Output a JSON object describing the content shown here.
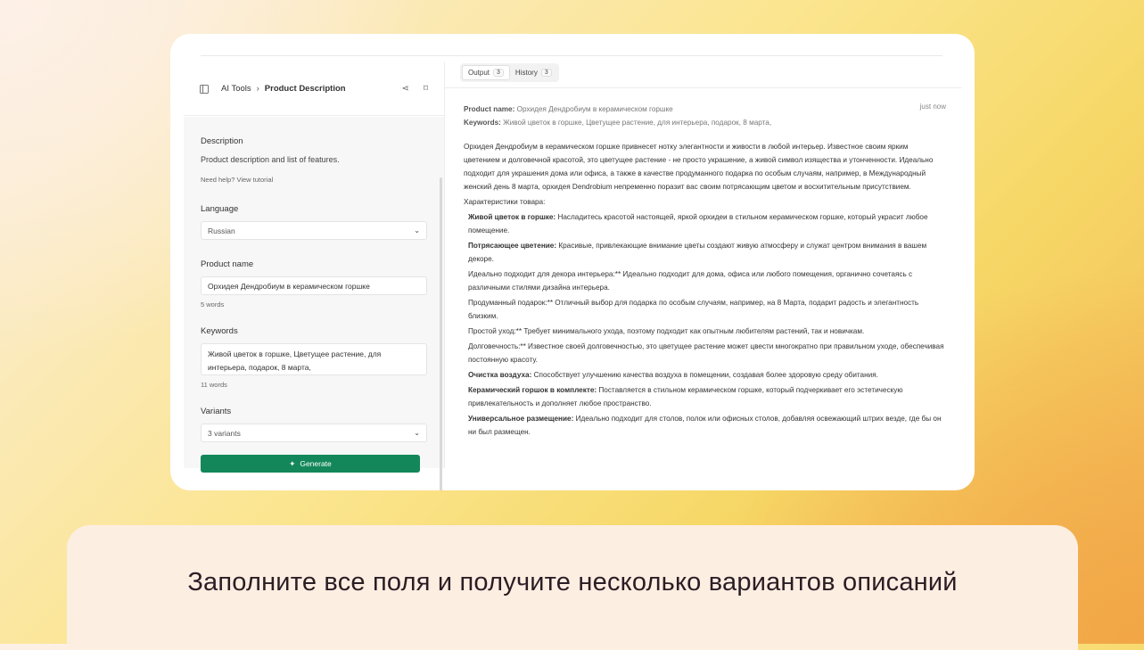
{
  "header": {
    "crumb_root": "AI Tools",
    "crumb_sep": "›",
    "crumb_current": "Product Description",
    "share_glyph": "⋖",
    "bookmark_glyph": "⌑"
  },
  "form": {
    "description_label": "Description",
    "description_text": "Product description and list of features.",
    "help_text": "Need help? View tutorial",
    "language_label": "Language",
    "language_value": "Russian",
    "product_name_label": "Product name",
    "product_name_value": "Орхидея Дендробиум в керамическом горшке",
    "product_name_count": "5 words",
    "keywords_label": "Keywords",
    "keywords_value": "Живой цветок в горшке, Цветущее растение, для интерьера, подарок, 8 марта,",
    "keywords_count": "11 words",
    "variants_label": "Variants",
    "variants_value": "3 variants",
    "generate_label": "Generate"
  },
  "tabs": [
    {
      "label": "Output",
      "count": "3"
    },
    {
      "label": "History",
      "count": "3"
    }
  ],
  "output": {
    "product_name_key": "Product name:",
    "product_name_val": "Орхидея Дендробиум в керамическом горшке",
    "keywords_key": "Keywords:",
    "keywords_val": "Живой цветок в горшке, Цветущее растение, для интерьера, подарок, 8 марта,",
    "timestamp": "just now",
    "intro": "Орхидея Дендробиум в керамическом горшке привнесет нотку элегантности и живости в любой интерьер. Известное своим ярким цветением и долговечной красотой, это цветущее растение - не просто украшение, а живой символ изящества и утонченности. Идеально подходит для украшения дома или офиса, а также в качестве продуманного подарка по особым случаям, например, в Международный женский день 8 марта, орхидея Dendrobium непременно поразит вас своим потрясающим цветом и восхитительным присутствием.",
    "features_heading": "Характеристики товара:",
    "features": [
      {
        "bold": "Живой цветок в горшке:",
        "text": " Насладитесь красотой настоящей, яркой орхидеи в стильном керамическом горшке, который украсит любое помещение."
      },
      {
        "bold": "Потрясающее цветение:",
        "text": " Красивые, привлекающие внимание цветы создают живую атмосферу и служат центром внимания в вашем декоре."
      },
      {
        "bold": "",
        "text": "Идеально подходит для декора интерьера:** Идеально подходит для дома, офиса или любого помещения, органично сочетаясь с различными стилями дизайна интерьера."
      },
      {
        "bold": "",
        "text": "Продуманный подарок:** Отличный выбор для подарка по особым случаям, например, на 8 Марта, подарит радость и элегантность близким."
      },
      {
        "bold": "",
        "text": "Простой уход:** Требует минимального ухода, поэтому подходит как опытным любителям растений, так и новичкам."
      },
      {
        "bold": "",
        "text": "Долговечность:** Известное своей долговечностью, это цветущее растение может цвести многократно при правильном уходе, обеспечивая постоянную красоту."
      },
      {
        "bold": "Очистка воздуха:",
        "text": " Способствует улучшению качества воздуха в помещении, создавая более здоровую среду обитания."
      },
      {
        "bold": "Керамический горшок в комплекте:",
        "text": " Поставляется в стильном керамическом горшке, который подчеркивает его эстетическую привлекательность и дополняет любое пространство."
      },
      {
        "bold": "Универсальное размещение:",
        "text": " Идеально подходит для столов, полок или офисных столов, добавляя освежающий штрих везде, где бы он ни был размещен."
      }
    ]
  },
  "caption": "Заполните все поля и получите несколько вариантов описаний",
  "colors": {
    "accent": "#13875a",
    "caption_bg": "#fdeee2"
  }
}
